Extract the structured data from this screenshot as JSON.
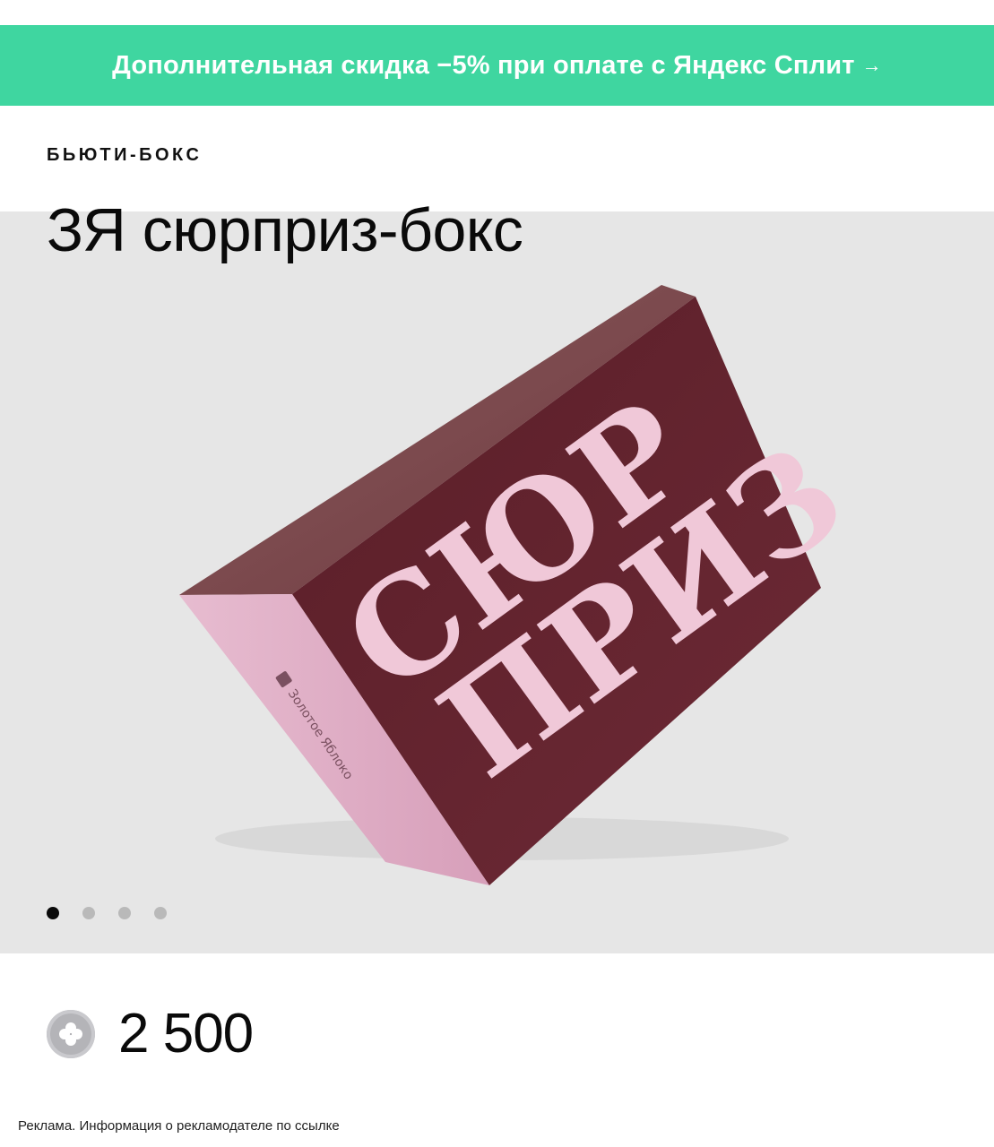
{
  "promo": {
    "text": "Дополнительная скидка −5% при оплате с Яндекс Сплит",
    "arrow": "→",
    "color": "#3fd6a0"
  },
  "product": {
    "category": "БЬЮТИ-БОКС",
    "title": "ЗЯ сюрприз-бокс",
    "box_side_text": "Золотое Яблоко"
  },
  "gallery": {
    "count": 4,
    "active_index": 0
  },
  "price": {
    "value": "2 500",
    "icon": "plus-points-icon"
  },
  "disclaimer": "Реклама. Информация о рекламодателе по ссылке"
}
